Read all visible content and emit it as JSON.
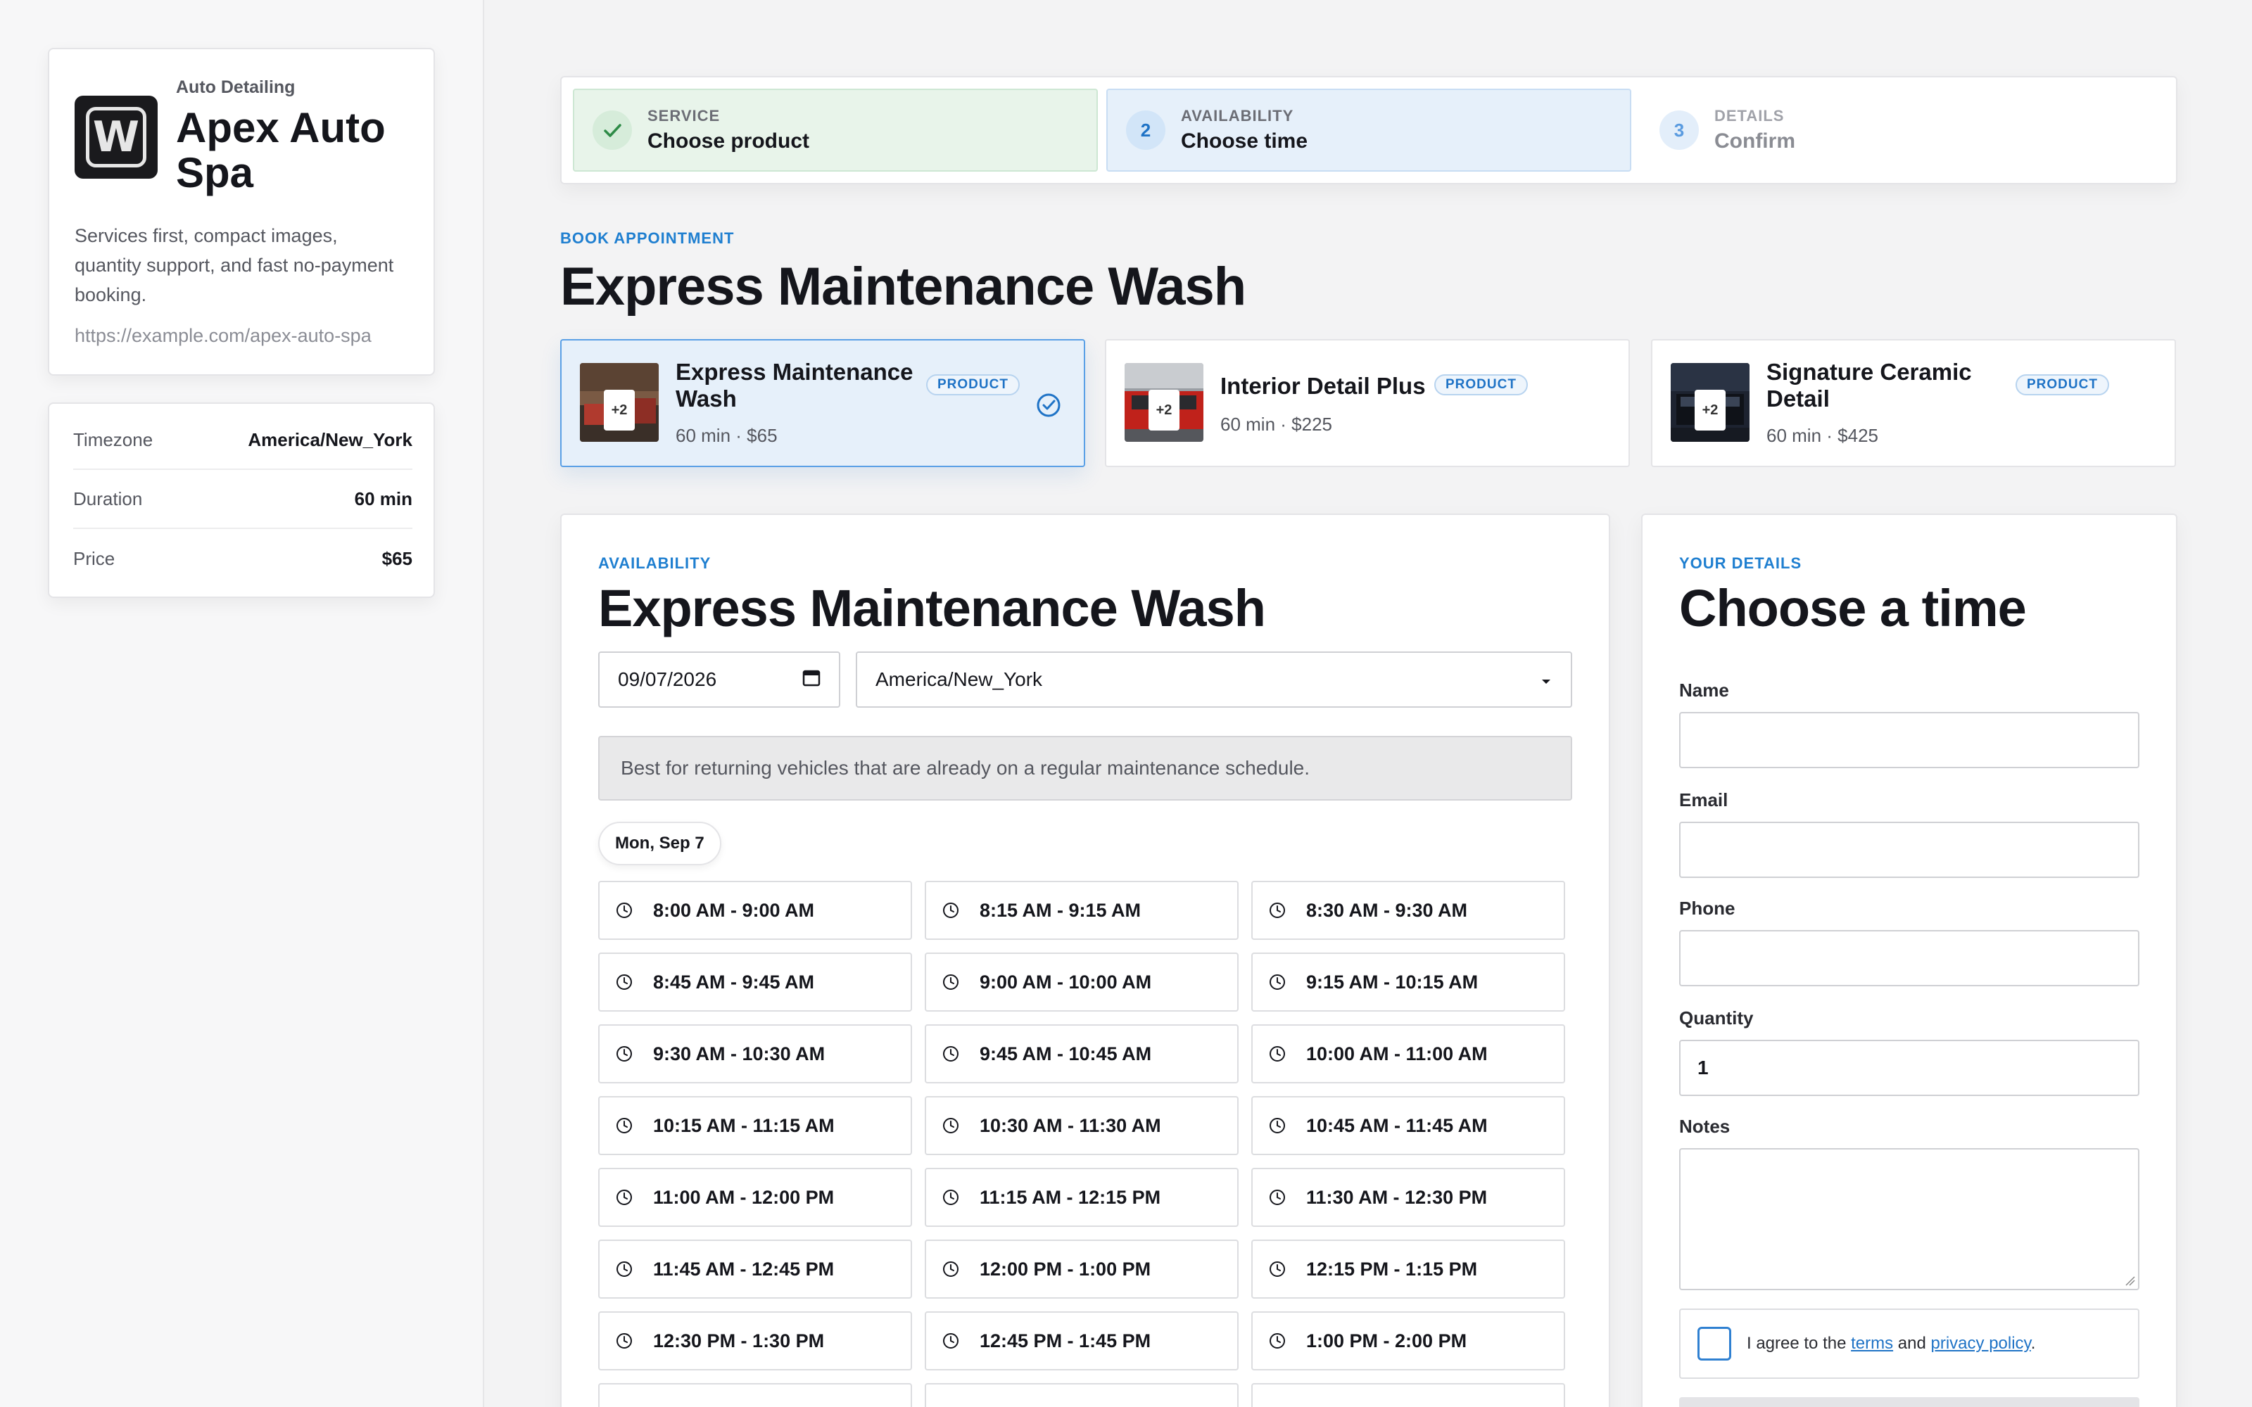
{
  "business": {
    "category": "Auto Detailing",
    "name": "Apex Auto Spa",
    "description": "Services first, compact images, quantity support, and fast no-payment booking.",
    "url": "https://example.com/apex-auto-spa",
    "logo_letter": "W"
  },
  "info": [
    {
      "label": "Timezone",
      "value": "America/New_York"
    },
    {
      "label": "Duration",
      "value": "60 min"
    },
    {
      "label": "Price",
      "value": "$65"
    }
  ],
  "steps": [
    {
      "number": "✓",
      "kicker": "SERVICE",
      "title": "Choose product",
      "state": "done"
    },
    {
      "number": "2",
      "kicker": "AVAILABILITY",
      "title": "Choose time",
      "state": "current"
    },
    {
      "number": "3",
      "kicker": "DETAILS",
      "title": "Confirm",
      "state": "upcoming"
    }
  ],
  "page": {
    "kicker": "BOOK APPOINTMENT",
    "title": "Express Maintenance Wash"
  },
  "products": [
    {
      "name_line1": "Express Maintenance",
      "name_line2": "Wash",
      "meta": "60 min · $65",
      "badge": "PRODUCT",
      "extra_images": "+2",
      "selected": true
    },
    {
      "name_line1": "Interior Detail Plus",
      "name_line2": "",
      "meta": "60 min · $225",
      "badge": "PRODUCT",
      "extra_images": "+2",
      "selected": false
    },
    {
      "name_line1": "Signature Ceramic",
      "name_line2": "Detail",
      "meta": "60 min · $425",
      "badge": "PRODUCT",
      "extra_images": "+2",
      "selected": false
    }
  ],
  "availability": {
    "kicker": "AVAILABILITY",
    "title": "Express Maintenance Wash",
    "date": "09/07/2026",
    "timezone": "America/New_York",
    "description": "Best for returning vehicles that are already on a regular maintenance schedule.",
    "day_label": "Mon, Sep 7",
    "slots": [
      "8:00 AM - 9:00 AM",
      "8:15 AM - 9:15 AM",
      "8:30 AM - 9:30 AM",
      "8:45 AM - 9:45 AM",
      "9:00 AM - 10:00 AM",
      "9:15 AM - 10:15 AM",
      "9:30 AM - 10:30 AM",
      "9:45 AM - 10:45 AM",
      "10:00 AM - 11:00 AM",
      "10:15 AM - 11:15 AM",
      "10:30 AM - 11:30 AM",
      "10:45 AM - 11:45 AM",
      "11:00 AM - 12:00 PM",
      "11:15 AM - 12:15 PM",
      "11:30 AM - 12:30 PM",
      "11:45 AM - 12:45 PM",
      "12:00 PM - 1:00 PM",
      "12:15 PM - 1:15 PM",
      "12:30 PM - 1:30 PM",
      "12:45 PM - 1:45 PM",
      "1:00 PM - 2:00 PM"
    ]
  },
  "details": {
    "kicker": "YOUR DETAILS",
    "title": "Choose a time",
    "name_label": "Name",
    "name_value": "",
    "email_label": "Email",
    "email_value": "",
    "phone_label": "Phone",
    "phone_value": "",
    "quantity_label": "Quantity",
    "quantity_value": "1",
    "notes_label": "Notes",
    "agree_prefix": "I agree to the",
    "terms_link": "terms",
    "agree_and": "and",
    "privacy_link": "privacy policy",
    "agree_suffix": "."
  },
  "colors": {
    "accent": "#1f73c6",
    "success": "#2e8b47",
    "text": "#15161c",
    "muted": "#55575f"
  }
}
